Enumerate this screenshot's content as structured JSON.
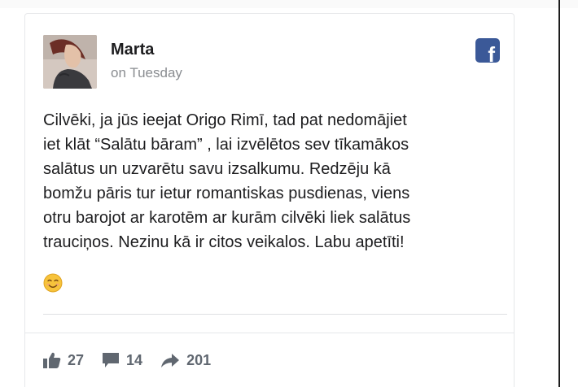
{
  "post": {
    "author": "Marta",
    "time": "on Tuesday",
    "source_icon": "facebook-icon",
    "text_lines": [
      "Cilvēki, ja jūs ieejat Origo Rimī, tad pat nedomājiet",
      "iet klāt “Salātu bāram” , lai izvēlētos sev tīkamākos",
      "salātus un uzvarētu savu izsalkumu. Redzēju kā",
      "bomžu pāris tur ietur romantiskas pusdienas, viens",
      "otru barojot ar karotēm ar kurām cilvēki liek salātus",
      "trauciņos. Nezinu kā ir citos veikalos. Labu apetīti!"
    ],
    "emoji": "smiling-face-emoji"
  },
  "stats": {
    "likes": "27",
    "comments": "14",
    "shares": "201"
  },
  "colors": {
    "facebook_blue": "#3b5998",
    "text": "#1d1d1f",
    "muted": "#8a8d91",
    "stat_gray": "#606770"
  }
}
